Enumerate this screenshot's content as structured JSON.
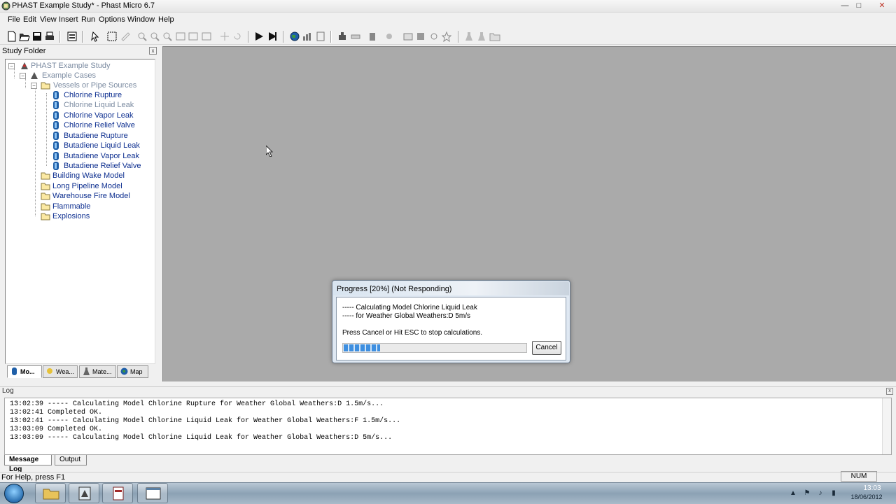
{
  "window": {
    "title": "PHAST Example Study* - Phast Micro 6.7",
    "minimize": "—",
    "maximize": "□",
    "close": "✕"
  },
  "menu": [
    "File",
    "Edit",
    "View",
    "Insert",
    "Run",
    "Options",
    "Window",
    "Help"
  ],
  "study_folder": {
    "header": "Study Folder",
    "close": "x",
    "tree": {
      "root": "PHAST Example Study",
      "example_cases": "Example Cases",
      "vessels_folder": "Vessels or Pipe Sources",
      "models": [
        {
          "label": "Chlorine Rupture",
          "state": "normal"
        },
        {
          "label": "Chlorine Liquid Leak",
          "state": "dim"
        },
        {
          "label": "Chlorine Vapor Leak",
          "state": "normal"
        },
        {
          "label": "Chlorine Relief Valve",
          "state": "normal"
        },
        {
          "label": "Butadiene Rupture",
          "state": "normal"
        },
        {
          "label": "Butadiene Liquid Leak",
          "state": "normal"
        },
        {
          "label": "Butadiene Vapor Leak",
          "state": "normal"
        },
        {
          "label": "Butadiene Relief Valve",
          "state": "normal"
        }
      ],
      "folders": [
        "Building Wake Model",
        "Long Pipeline Model",
        "Warehouse Fire Model",
        "Flammable",
        "Explosions"
      ]
    },
    "tabs": [
      "Mo...",
      "Wea...",
      "Mate...",
      "Map"
    ]
  },
  "progress_dialog": {
    "title": "Progress [20%]  (Not Responding)",
    "line1": "----- Calculating Model Chlorine Liquid Leak",
    "line2": "----- for Weather Global Weathers:D 5m/s",
    "line3": "Press Cancel or Hit ESC to stop calculations.",
    "progress": 0.2,
    "cancel": "Cancel"
  },
  "log": {
    "header": "Log",
    "lines": [
      "13:02:39 ----- Calculating Model Chlorine Rupture for Weather Global Weathers:D 1.5m/s...",
      "13:02:41 Completed OK.",
      "13:02:41 ----- Calculating Model Chlorine Liquid Leak for Weather Global Weathers:F 1.5m/s...",
      "13:03:09 Completed OK.",
      "13:03:09 ----- Calculating Model Chlorine Liquid Leak for Weather Global Weathers:D 5m/s..."
    ],
    "tabs": [
      "Message Log",
      "Output"
    ]
  },
  "status": {
    "help_text": "For Help, press F1",
    "num": "NUM"
  },
  "taskbar": {
    "time": "13:03",
    "date": "18/06/2012"
  },
  "colors": {
    "workspace": "#aaaaaa",
    "progress_fill": "#3e8fe0",
    "selected_text": "#0c2e8f"
  }
}
